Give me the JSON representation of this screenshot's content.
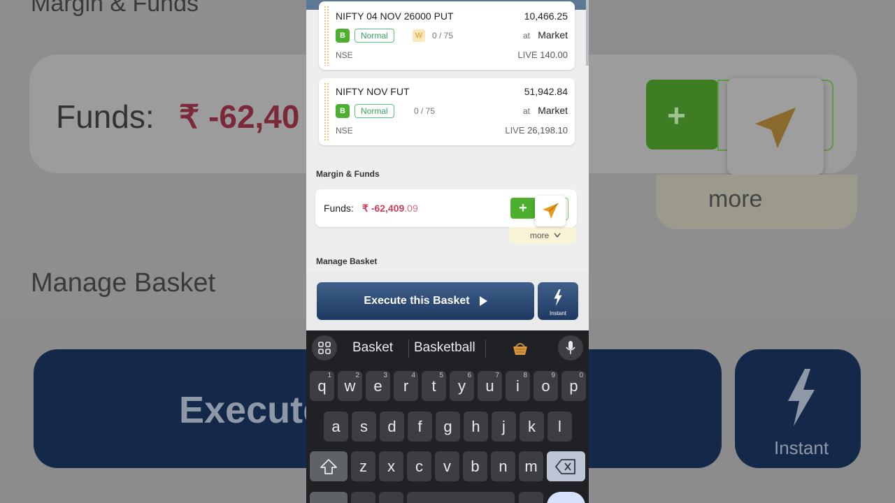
{
  "background": {
    "margin_title": "Margin & Funds",
    "funds_label": "Funds:",
    "funds_value": "₹ -62,40",
    "more_label": "more",
    "manage_title": "Manage Basket",
    "execute_text": "Execute",
    "instant_label": "Instant"
  },
  "orders": [
    {
      "name": "NIFTY 04 NOV 26000 PUT",
      "price": "10,466.25",
      "side": "B",
      "product": "Normal",
      "tag": "W",
      "qty": "0 / 75",
      "at": "at",
      "order_type": "Market",
      "exchange": "NSE",
      "live_label": "LIVE",
      "live_value": "140.00"
    },
    {
      "name": "NIFTY NOV FUT",
      "price": "51,942.84",
      "side": "B",
      "product": "Normal",
      "qty": "0 / 75",
      "at": "at",
      "order_type": "Market",
      "exchange": "NSE",
      "live_label": "LIVE",
      "live_value": "26,198.10"
    }
  ],
  "margin": {
    "title": "Margin & Funds",
    "funds_label": "Funds:",
    "currency": "₹",
    "value_int": "-62,409",
    "value_dec": ".09",
    "add_label": "+",
    "more_label": "more"
  },
  "manage": {
    "title": "Manage Basket",
    "execute_label": "Execute this Basket",
    "instant_label": "Instant"
  },
  "keyboard": {
    "suggestions": [
      "Basket",
      "Basketball"
    ],
    "row1": [
      {
        "k": "q",
        "h": "1"
      },
      {
        "k": "w",
        "h": "2"
      },
      {
        "k": "e",
        "h": "3"
      },
      {
        "k": "r",
        "h": "4"
      },
      {
        "k": "t",
        "h": "5"
      },
      {
        "k": "y",
        "h": "6"
      },
      {
        "k": "u",
        "h": "7"
      },
      {
        "k": "i",
        "h": "8"
      },
      {
        "k": "o",
        "h": "9"
      },
      {
        "k": "p",
        "h": "0"
      }
    ],
    "row2": [
      "a",
      "s",
      "d",
      "f",
      "g",
      "h",
      "j",
      "k",
      "l"
    ],
    "row3": [
      "z",
      "x",
      "c",
      "v",
      "b",
      "n",
      "m"
    ]
  },
  "colors": {
    "navy": "#1e3a62",
    "green": "#4caf2e",
    "negative": "#cf3b55",
    "send_icon": "#e39a1c"
  }
}
